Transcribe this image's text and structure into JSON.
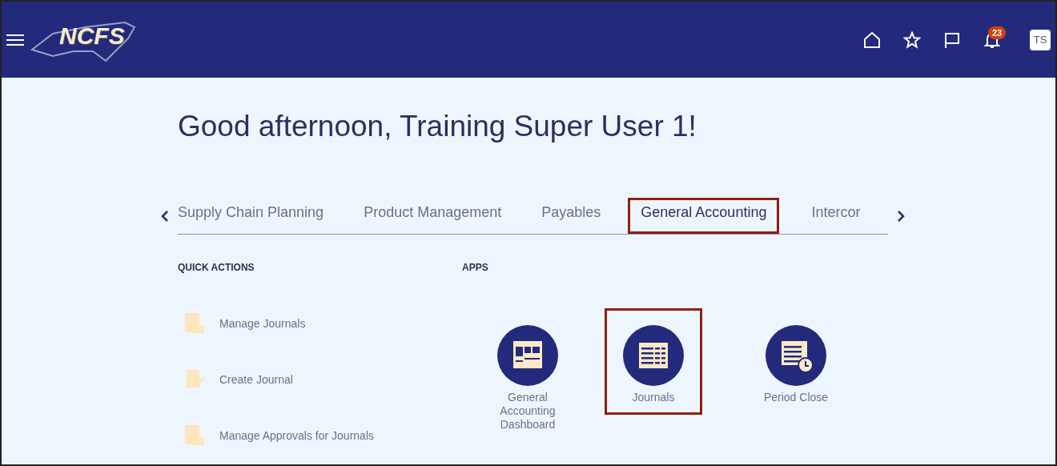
{
  "header": {
    "logo": "NCFS",
    "notifications": "23",
    "avatar": "TS"
  },
  "greeting": "Good afternoon, Training Super User 1!",
  "tabs": [
    {
      "label": "Supply Chain Planning",
      "selected": false,
      "highlighted": false
    },
    {
      "label": "Product Management",
      "selected": false,
      "highlighted": false
    },
    {
      "label": "Payables",
      "selected": false,
      "highlighted": false
    },
    {
      "label": "General Accounting",
      "selected": true,
      "highlighted": true
    },
    {
      "label": "Intercor",
      "selected": false,
      "highlighted": false
    }
  ],
  "quick_actions": {
    "title": "QUICK ACTIONS",
    "items": [
      {
        "label": "Manage Journals",
        "kind": "list"
      },
      {
        "label": "Create Journal",
        "kind": "edit"
      },
      {
        "label": "Manage Approvals for Journals",
        "kind": "list"
      }
    ]
  },
  "apps": {
    "title": "APPS",
    "items": [
      {
        "label": "General Accounting Dashboard",
        "kind": "dashboard",
        "highlighted": false
      },
      {
        "label": "Journals",
        "kind": "table",
        "highlighted": true
      },
      {
        "label": "Period Close",
        "kind": "clock-table",
        "highlighted": false
      }
    ]
  }
}
